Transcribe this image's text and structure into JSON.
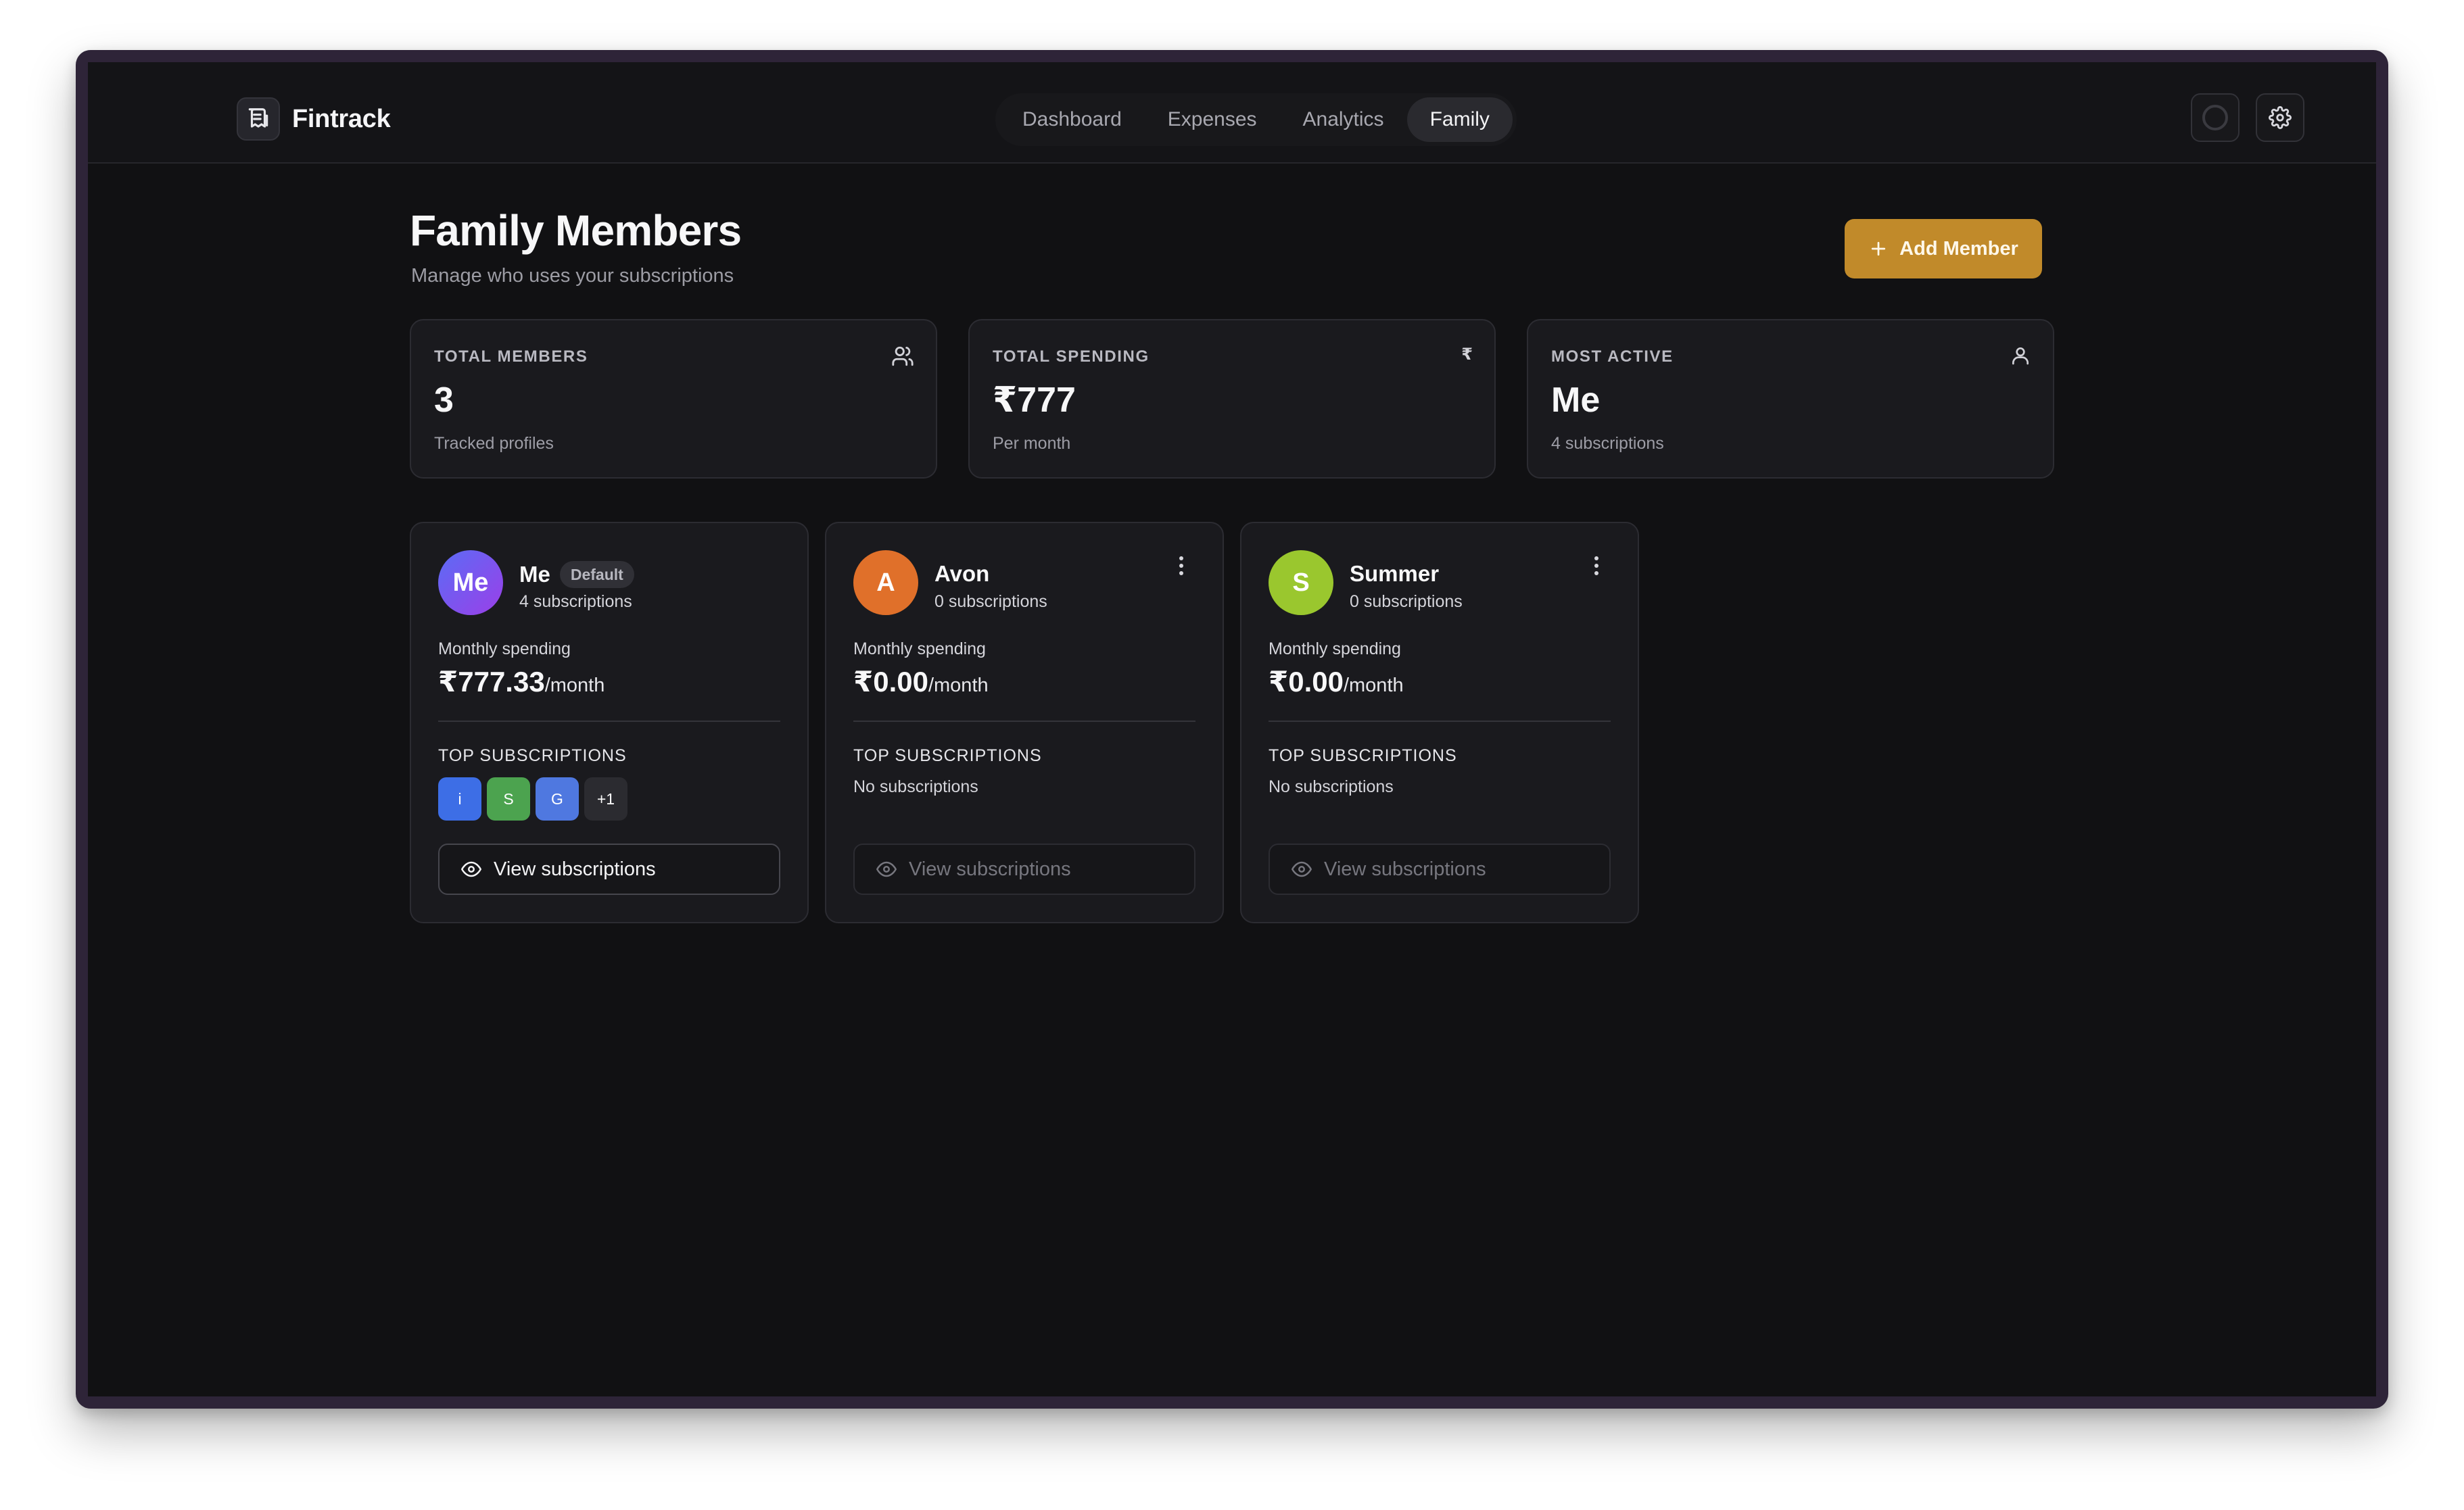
{
  "app": {
    "name": "Fintrack",
    "icon": "receipt-icon"
  },
  "nav": {
    "tabs": [
      {
        "label": "Dashboard",
        "active": false
      },
      {
        "label": "Expenses",
        "active": false
      },
      {
        "label": "Analytics",
        "active": false
      },
      {
        "label": "Family",
        "active": true
      }
    ],
    "theme_button_icon": "circle-icon",
    "settings_button_icon": "gear-icon"
  },
  "header": {
    "title": "Family Members",
    "subtitle": "Manage who uses your subscriptions",
    "add_button": "Add Member",
    "add_button_color": "#c18a2a"
  },
  "stats": [
    {
      "label": "TOTAL MEMBERS",
      "value": "3",
      "caption": "Tracked profiles",
      "icon": "users-icon"
    },
    {
      "label": "TOTAL SPENDING",
      "value": "₹777",
      "caption": "Per month",
      "icon": "rupee-icon",
      "icon_text": "₹"
    },
    {
      "label": "MOST ACTIVE",
      "value": "Me",
      "caption": "4 subscriptions",
      "icon": "user-icon"
    }
  ],
  "members": [
    {
      "initials": "Me",
      "name": "Me",
      "badge": "Default",
      "subscriptions": "4 subscriptions",
      "spending_label": "Monthly spending",
      "spending_value": "₹777.33",
      "spending_unit": "/month",
      "top_label": "TOP SUBSCRIPTIONS",
      "chips": [
        {
          "text": "i",
          "color": "#3d6ee6"
        },
        {
          "text": "S",
          "color": "#4ca34f"
        },
        {
          "text": "G",
          "color": "#4f78e0"
        },
        {
          "text": "+1",
          "color": "#2b2b30"
        }
      ],
      "view_label": "View subscriptions",
      "avatar_color": "#7b4df2"
    },
    {
      "initials": "A",
      "name": "Avon",
      "subscriptions": "0 subscriptions",
      "spending_label": "Monthly spending",
      "spending_value": "₹0.00",
      "spending_unit": "/month",
      "top_label": "TOP SUBSCRIPTIONS",
      "empty_text": "No subscriptions",
      "view_label": "View subscriptions",
      "avatar_color": "#e0702a"
    },
    {
      "initials": "S",
      "name": "Summer",
      "subscriptions": "0 subscriptions",
      "spending_label": "Monthly spending",
      "spending_value": "₹0.00",
      "spending_unit": "/month",
      "top_label": "TOP SUBSCRIPTIONS",
      "empty_text": "No subscriptions",
      "view_label": "View subscriptions",
      "avatar_color": "#9ac72e"
    }
  ]
}
